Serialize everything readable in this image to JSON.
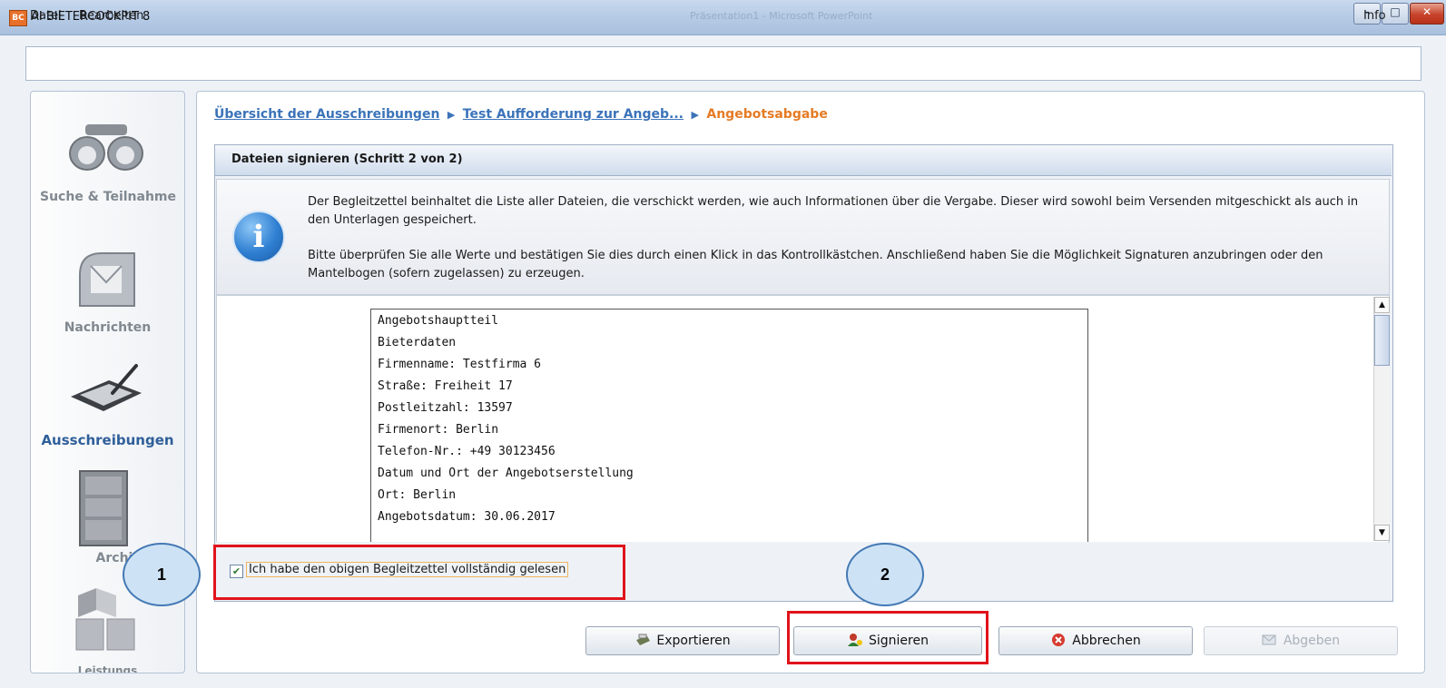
{
  "window": {
    "app_icon_text": "BC",
    "title": "AI BIETERCOCKPIT 8",
    "background_title": "Präsentation1 - Microsoft PowerPoint",
    "minimize": "–",
    "maximize": "□",
    "close": "✕"
  },
  "menu": {
    "file": "Datei",
    "edit": "Bearbeiten",
    "info": "Info"
  },
  "sidebar": {
    "items": [
      {
        "label": "Suche & Teilnahme",
        "active": false
      },
      {
        "label": "Nachrichten",
        "active": false
      },
      {
        "label": "Ausschreibungen",
        "active": true
      },
      {
        "label": "Archiv",
        "active": false
      },
      {
        "label": "Leistungs",
        "active": false
      }
    ]
  },
  "breadcrumb": {
    "items": [
      "Übersicht der Ausschreibungen",
      "Test Aufforderung zur Angeb..."
    ],
    "current": "Angebotsabgabe",
    "separator": "▶"
  },
  "step": {
    "title": "Dateien signieren (Schritt 2 von 2)"
  },
  "info": {
    "icon_glyph": "i",
    "paragraph1": "Der Begleitzettel beinhaltet die Liste aller Dateien, die verschickt werden, wie auch Informationen über die Vergabe. Dieser wird sowohl beim Versenden mitgeschickt als auch in den Unterlagen gespeichert.",
    "paragraph2": "Bitte überprüfen Sie alle Werte und bestätigen Sie dies durch einen Klick in das Kontrollkästchen. Anschließend haben Sie die Möglichkeit Signaturen anzubringen oder den Mantelbogen (sofern zugelassen) zu erzeugen."
  },
  "document": {
    "lines": [
      "Angebotshauptteil",
      "Bieterdaten",
      "Firmenname: Testfirma 6",
      "Straße:  Freiheit 17",
      "Postleitzahl: 13597",
      "Firmenort: Berlin",
      "Telefon-Nr.: +49 30123456",
      "Datum und Ort der Angebotserstellung",
      "Ort: Berlin",
      "Angebotsdatum: 30.06.2017"
    ]
  },
  "scrollbar": {
    "up": "▲",
    "down": "▼"
  },
  "confirm": {
    "checked": true,
    "check_glyph": "✔",
    "label": "Ich habe den obigen Begleitzettel vollständig gelesen"
  },
  "buttons": {
    "export": "Exportieren",
    "sign": "Signieren",
    "cancel": "Abbrechen",
    "submit": "Abgeben"
  },
  "annotations": {
    "badge1": "1",
    "badge2": "2",
    "highlight_color": "#e0131b"
  },
  "colors": {
    "link": "#3b73b9",
    "current_crumb": "#e57b24",
    "active_nav": "#2f5f9a"
  }
}
